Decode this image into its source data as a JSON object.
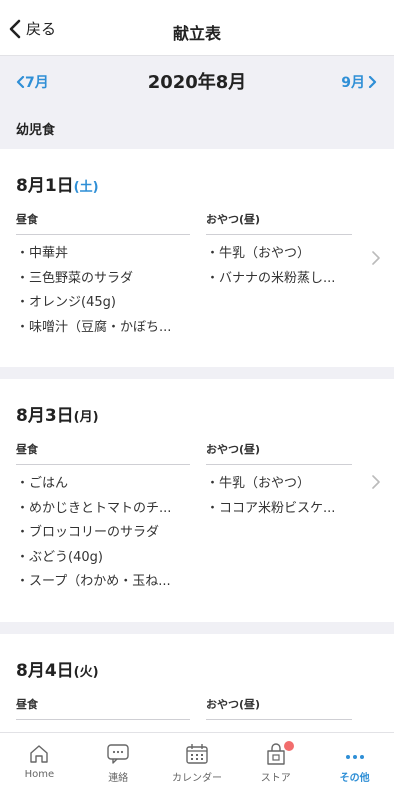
{
  "nav": {
    "back_label": "戻る",
    "title": "献立表"
  },
  "month": {
    "prev": "7月",
    "current": "2020年8月",
    "next": "9月"
  },
  "category": "幼児食",
  "days": [
    {
      "date": "8月1日",
      "weekday": "(土)",
      "lunch_header": "昼食",
      "lunch": [
        "・中華丼",
        "・三色野菜のサラダ",
        "・オレンジ(45g)",
        "・味噌汁（豆腐・かぼち..."
      ],
      "snack_header": "おやつ(昼)",
      "snack": [
        "・牛乳（おやつ）",
        "・バナナの米粉蒸し..."
      ]
    },
    {
      "date": "8月3日",
      "weekday": "(月)",
      "lunch_header": "昼食",
      "lunch": [
        "・ごはん",
        "・めかじきとトマトのチ...",
        "・ブロッコリーのサラダ",
        "・ぶどう(40g)",
        "・スープ（わかめ・玉ね..."
      ],
      "snack_header": "おやつ(昼)",
      "snack": [
        "・牛乳（おやつ）",
        "・ココア米粉ビスケ..."
      ]
    },
    {
      "date": "8月4日",
      "weekday": "(火)",
      "lunch_header": "昼食",
      "lunch": [],
      "snack_header": "おやつ(昼)",
      "snack": []
    }
  ],
  "tabs": [
    {
      "label": "Home",
      "icon": "home-icon"
    },
    {
      "label": "連絡",
      "icon": "chat-icon"
    },
    {
      "label": "カレンダー",
      "icon": "calendar-icon"
    },
    {
      "label": "ストア",
      "icon": "store-icon"
    },
    {
      "label": "その他",
      "icon": "more-icon"
    }
  ],
  "colors": {
    "accent": "#2f8fd6",
    "badge": "#f26d6d",
    "background": "#f0f0f5"
  }
}
